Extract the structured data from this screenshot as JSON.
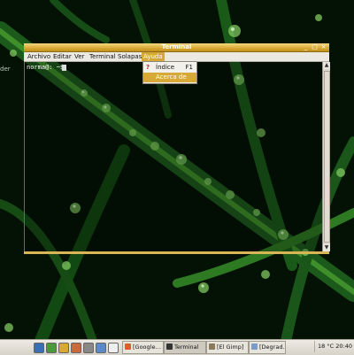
{
  "desktop": {
    "side_label": "der"
  },
  "window": {
    "title": "Terminal",
    "menu": [
      "Archivo",
      "Editar",
      "Ver",
      "Terminal",
      "Solapas",
      "Ayuda"
    ],
    "prompt": "norma@: ~$"
  },
  "help_menu": {
    "items": [
      {
        "label": "Índice",
        "shortcut": "F1",
        "icon": "help-icon"
      },
      {
        "label": "Acerca de",
        "shortcut": ""
      }
    ]
  },
  "taskbar": {
    "tasks": [
      "[Google…",
      "Terminal",
      "[El Gimp]",
      "[Degrad…"
    ],
    "tray": {
      "weather": "18 °C",
      "clock": "20:40"
    }
  },
  "colors": {
    "title_accent": "#d9a934",
    "menu_highlight": "#d7a936",
    "panel_bg": "#e3e0d8"
  }
}
